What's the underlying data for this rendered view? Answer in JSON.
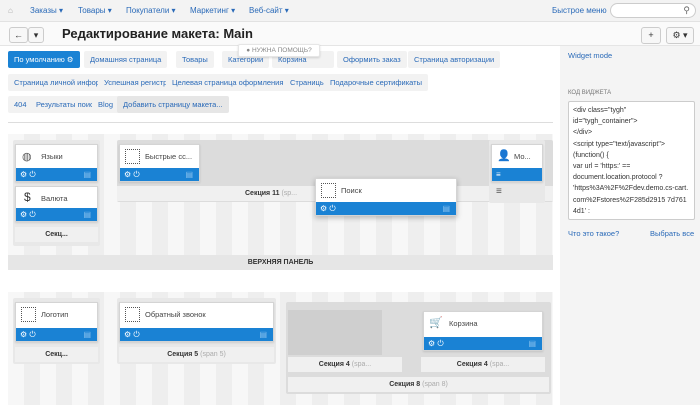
{
  "topnav": {
    "home_icon": "home-icon",
    "items": [
      "Заказы ▾",
      "Товары ▾",
      "Покупатели ▾",
      "Маркетинг ▾",
      "Веб-сайт ▾"
    ],
    "quick_menu": "Быстрое меню",
    "search_placeholder": ""
  },
  "header": {
    "back": "←",
    "dropdown": "▾",
    "title": "Редактирование макета: Main",
    "add": "+",
    "settings": "⚙ ▾"
  },
  "help_popup": "НУЖНА ПОМОЩЬ?",
  "tabs": [
    "По умолчанию ⚙",
    "Домашняя страница",
    "Товары",
    "Категории",
    "Корзина",
    "Оформить заказ",
    "Страница авторизации",
    "Страница личной информации",
    "Успешная регистрация",
    "Целевая страница оформления заказа",
    "Страницы",
    "Подарочные сертификаты",
    "404",
    "Результаты поиска",
    "Blog",
    "Добавить страницу макета..."
  ],
  "sidebar": {
    "widget_mode": "Widget mode",
    "code_label": "КОД ВИДЖЕТА",
    "code": "<div class=\"tygh\"\nid=\"tygh_container\">\n</div>\n<script type=\"text/javascript\">\n(function() {\nvar url = 'https:' ==\ndocument.location.protocol ?\n'https%3A%2F%2Fdev.demo.cs-cart.com%2Fstores%2F285d2915 7d7614d1' :",
    "what_is": "Что это такое?",
    "select_all": "Выбрать все"
  },
  "top_panel": {
    "title": "ВЕРХНЯЯ ПАНЕЛЬ",
    "blocks": {
      "languages": "Языки",
      "currency": "Валюта",
      "quick_links": "Быстрые сс...",
      "search": "Поиск",
      "my_account": "Мо..."
    },
    "sections": {
      "left": "Секц...",
      "middle": "Секция 11",
      "middle_span": "(sp..."
    }
  },
  "header_panel": {
    "blocks": {
      "logo": "Логотип",
      "callback": "Обратный звонок",
      "cart": "Корзина"
    },
    "sections": {
      "s1": "Секц...",
      "s5": "Секция 5",
      "s5_span": "(span 5)",
      "s4a": "Секция 4",
      "s4a_span": "(spa...",
      "s4b": "Секция 4",
      "s4b_span": "(spa...",
      "s8": "Секция 8",
      "s8_span": "(span 8)"
    }
  },
  "colors": {
    "accent": "#1a82d4",
    "link": "#2a6ab8"
  }
}
